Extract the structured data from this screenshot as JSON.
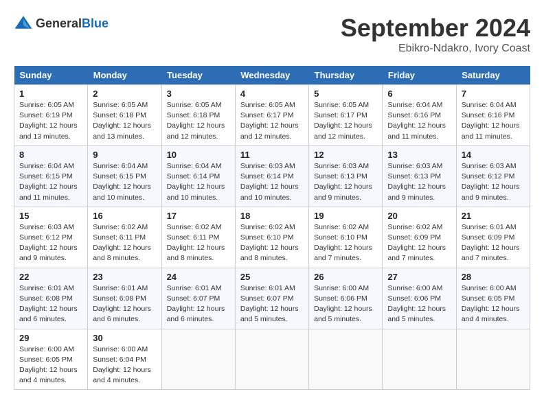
{
  "header": {
    "logo_general": "General",
    "logo_blue": "Blue",
    "month_year": "September 2024",
    "location": "Ebikro-Ndakro, Ivory Coast"
  },
  "columns": [
    "Sunday",
    "Monday",
    "Tuesday",
    "Wednesday",
    "Thursday",
    "Friday",
    "Saturday"
  ],
  "weeks": [
    [
      {
        "day": "1",
        "info": "Sunrise: 6:05 AM\nSunset: 6:19 PM\nDaylight: 12 hours\nand 13 minutes."
      },
      {
        "day": "2",
        "info": "Sunrise: 6:05 AM\nSunset: 6:18 PM\nDaylight: 12 hours\nand 13 minutes."
      },
      {
        "day": "3",
        "info": "Sunrise: 6:05 AM\nSunset: 6:18 PM\nDaylight: 12 hours\nand 12 minutes."
      },
      {
        "day": "4",
        "info": "Sunrise: 6:05 AM\nSunset: 6:17 PM\nDaylight: 12 hours\nand 12 minutes."
      },
      {
        "day": "5",
        "info": "Sunrise: 6:05 AM\nSunset: 6:17 PM\nDaylight: 12 hours\nand 12 minutes."
      },
      {
        "day": "6",
        "info": "Sunrise: 6:04 AM\nSunset: 6:16 PM\nDaylight: 12 hours\nand 11 minutes."
      },
      {
        "day": "7",
        "info": "Sunrise: 6:04 AM\nSunset: 6:16 PM\nDaylight: 12 hours\nand 11 minutes."
      }
    ],
    [
      {
        "day": "8",
        "info": "Sunrise: 6:04 AM\nSunset: 6:15 PM\nDaylight: 12 hours\nand 11 minutes."
      },
      {
        "day": "9",
        "info": "Sunrise: 6:04 AM\nSunset: 6:15 PM\nDaylight: 12 hours\nand 10 minutes."
      },
      {
        "day": "10",
        "info": "Sunrise: 6:04 AM\nSunset: 6:14 PM\nDaylight: 12 hours\nand 10 minutes."
      },
      {
        "day": "11",
        "info": "Sunrise: 6:03 AM\nSunset: 6:14 PM\nDaylight: 12 hours\nand 10 minutes."
      },
      {
        "day": "12",
        "info": "Sunrise: 6:03 AM\nSunset: 6:13 PM\nDaylight: 12 hours\nand 9 minutes."
      },
      {
        "day": "13",
        "info": "Sunrise: 6:03 AM\nSunset: 6:13 PM\nDaylight: 12 hours\nand 9 minutes."
      },
      {
        "day": "14",
        "info": "Sunrise: 6:03 AM\nSunset: 6:12 PM\nDaylight: 12 hours\nand 9 minutes."
      }
    ],
    [
      {
        "day": "15",
        "info": "Sunrise: 6:03 AM\nSunset: 6:12 PM\nDaylight: 12 hours\nand 9 minutes."
      },
      {
        "day": "16",
        "info": "Sunrise: 6:02 AM\nSunset: 6:11 PM\nDaylight: 12 hours\nand 8 minutes."
      },
      {
        "day": "17",
        "info": "Sunrise: 6:02 AM\nSunset: 6:11 PM\nDaylight: 12 hours\nand 8 minutes."
      },
      {
        "day": "18",
        "info": "Sunrise: 6:02 AM\nSunset: 6:10 PM\nDaylight: 12 hours\nand 8 minutes."
      },
      {
        "day": "19",
        "info": "Sunrise: 6:02 AM\nSunset: 6:10 PM\nDaylight: 12 hours\nand 7 minutes."
      },
      {
        "day": "20",
        "info": "Sunrise: 6:02 AM\nSunset: 6:09 PM\nDaylight: 12 hours\nand 7 minutes."
      },
      {
        "day": "21",
        "info": "Sunrise: 6:01 AM\nSunset: 6:09 PM\nDaylight: 12 hours\nand 7 minutes."
      }
    ],
    [
      {
        "day": "22",
        "info": "Sunrise: 6:01 AM\nSunset: 6:08 PM\nDaylight: 12 hours\nand 6 minutes."
      },
      {
        "day": "23",
        "info": "Sunrise: 6:01 AM\nSunset: 6:08 PM\nDaylight: 12 hours\nand 6 minutes."
      },
      {
        "day": "24",
        "info": "Sunrise: 6:01 AM\nSunset: 6:07 PM\nDaylight: 12 hours\nand 6 minutes."
      },
      {
        "day": "25",
        "info": "Sunrise: 6:01 AM\nSunset: 6:07 PM\nDaylight: 12 hours\nand 5 minutes."
      },
      {
        "day": "26",
        "info": "Sunrise: 6:00 AM\nSunset: 6:06 PM\nDaylight: 12 hours\nand 5 minutes."
      },
      {
        "day": "27",
        "info": "Sunrise: 6:00 AM\nSunset: 6:06 PM\nDaylight: 12 hours\nand 5 minutes."
      },
      {
        "day": "28",
        "info": "Sunrise: 6:00 AM\nSunset: 6:05 PM\nDaylight: 12 hours\nand 4 minutes."
      }
    ],
    [
      {
        "day": "29",
        "info": "Sunrise: 6:00 AM\nSunset: 6:05 PM\nDaylight: 12 hours\nand 4 minutes."
      },
      {
        "day": "30",
        "info": "Sunrise: 6:00 AM\nSunset: 6:04 PM\nDaylight: 12 hours\nand 4 minutes."
      },
      {
        "day": "",
        "info": ""
      },
      {
        "day": "",
        "info": ""
      },
      {
        "day": "",
        "info": ""
      },
      {
        "day": "",
        "info": ""
      },
      {
        "day": "",
        "info": ""
      }
    ]
  ]
}
